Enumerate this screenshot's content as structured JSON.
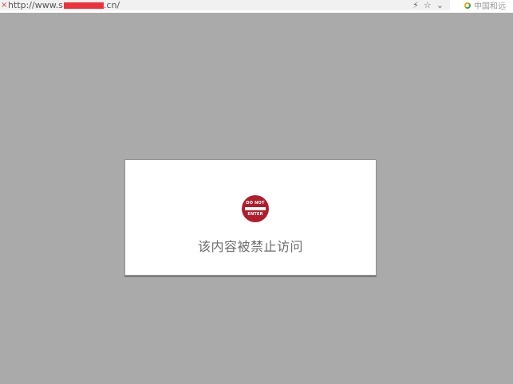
{
  "browser": {
    "url_prefix": "http://www.s",
    "url_suffix": ".cn/",
    "close_glyph": "×",
    "icons": [
      "lightning-icon",
      "star-icon",
      "chevron-down-icon"
    ],
    "search_placeholder": "中国和远",
    "colors": {
      "redaction": "#f0303a",
      "background": "#aaaaaa"
    }
  },
  "dialog": {
    "sign_top": "DO NOT",
    "sign_bottom": "ENTER",
    "message": "该内容被禁止访问",
    "sign_color": "#b01d2b"
  }
}
